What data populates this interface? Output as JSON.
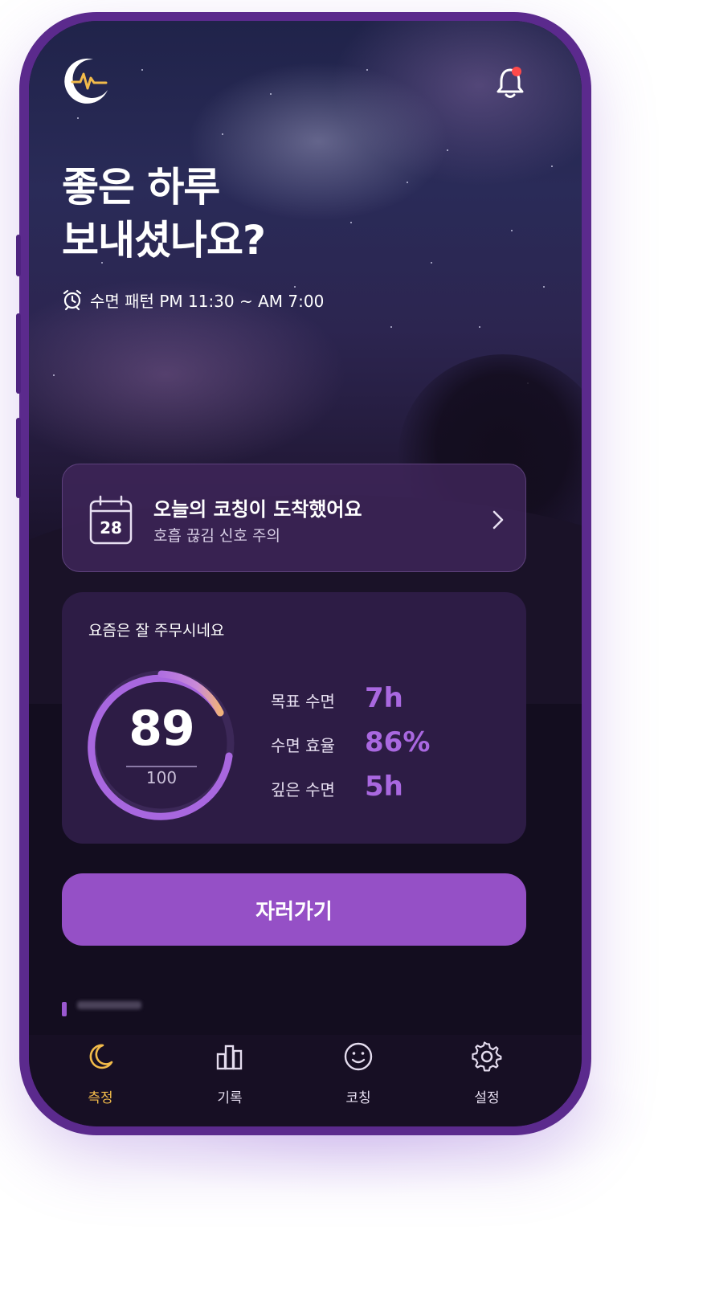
{
  "header": {
    "greeting_line1": "좋은 하루",
    "greeting_line2": "보내셨나요?",
    "sleep_pattern": "수면 패턴 PM 11:30 ~ AM 7:00",
    "logo_icon": "moon-heartbeat-icon",
    "bell_icon": "bell-icon",
    "has_notification": true
  },
  "coaching_card": {
    "calendar_day": "28",
    "title": "오늘의 코칭이 도착했어요",
    "subtitle": "호흡 끊김 신호 주의",
    "icon": "calendar-icon"
  },
  "score_card": {
    "caption": "요즘은 잘 주무시네요",
    "score": "89",
    "max": "100",
    "metrics": [
      {
        "label": "목표 수면",
        "value": "7h"
      },
      {
        "label": "수면 효율",
        "value": "86%"
      },
      {
        "label": "깊은 수면",
        "value": "5h"
      }
    ]
  },
  "primary_button": {
    "label": "자러가기"
  },
  "tabs": [
    {
      "label": "측정",
      "icon": "moon-icon",
      "active": true
    },
    {
      "label": "기록",
      "icon": "bar-chart-icon",
      "active": false
    },
    {
      "label": "코칭",
      "icon": "smile-icon",
      "active": false
    },
    {
      "label": "설정",
      "icon": "gear-icon",
      "active": false
    }
  ],
  "colors": {
    "accent": "#9550c6",
    "metric_value": "#a968e0",
    "active_tab": "#f2bb4a",
    "notification_dot": "#ff4a4a",
    "phone_frame": "#5b2a8d"
  }
}
